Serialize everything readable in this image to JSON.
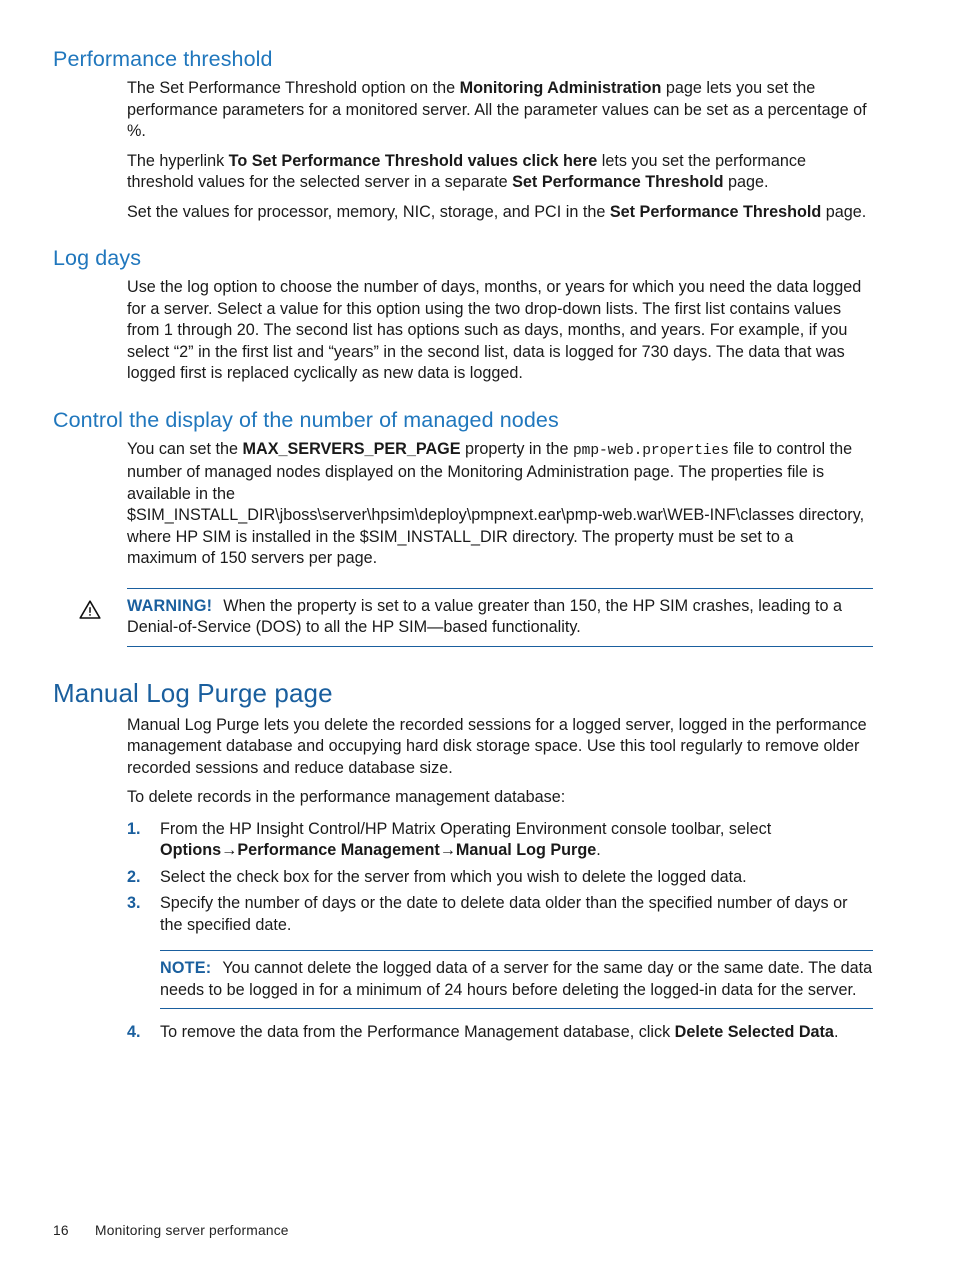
{
  "sections": {
    "performance_threshold": {
      "heading": "Performance threshold",
      "p1_a": "The Set Performance Threshold option on the ",
      "p1_b": "Monitoring Administration",
      "p1_c": " page lets you set the performance parameters for a monitored server. All the parameter values can be set as a percentage of %.",
      "p2_a": "The hyperlink ",
      "p2_b": "To Set Performance Threshold values click here",
      "p2_c": " lets you set the performance threshold values for the selected server in a separate ",
      "p2_d": "Set Performance Threshold",
      "p2_e": " page.",
      "p3_a": "Set the values for processor, memory, NIC, storage, and PCI in the ",
      "p3_b": "Set Performance Threshold",
      "p3_c": " page."
    },
    "log_days": {
      "heading": "Log days",
      "p1": "Use the log option to choose the number of days, months, or years for which you need the data logged for a server. Select a value for this option using the two drop-down lists. The first list contains values from 1 through 20. The second list has options such as days, months, and years. For example, if you select “2” in the first list and “years” in the second list, data is logged for 730 days. The data that was logged first is replaced cyclically as new data is logged."
    },
    "control_display": {
      "heading": "Control the display of the number of managed nodes",
      "p1_a": "You can set the ",
      "p1_b": "MAX_SERVERS_PER_PAGE",
      "p1_c": " property in the ",
      "p1_mono": "pmp-web.properties",
      "p1_d": " file to control the number of managed nodes displayed on the Monitoring Administration page. The properties file is available in the",
      "p1_path": "$SIM_INSTALL_DIR\\jboss\\server\\hpsim\\deploy\\pmpnext.ear\\pmp-web.war\\WEB-INF\\classes",
      "p1_e": " directory, where HP SIM is installed in the $SIM_INSTALL_DIR directory. The property must be set to a maximum of 150 servers per page."
    },
    "warning": {
      "icon": "warning-triangle-icon",
      "label": "WARNING!",
      "text": "When the property is set to a value greater than 150, the HP SIM crashes, leading to a Denial-of-Service (DOS) to all the HP SIM—based functionality."
    },
    "manual_log_purge": {
      "heading": "Manual Log Purge page",
      "p1": "Manual Log Purge lets you delete the recorded sessions for a logged server, logged in the performance management database and occupying hard disk storage space. Use this tool regularly to remove older recorded sessions and reduce database size.",
      "p2": "To delete records in the performance management database:",
      "steps": [
        {
          "num": "1.",
          "text_a": "From the HP Insight Control/HP Matrix Operating Environment console toolbar, select ",
          "text_b": "Options→Performance Management→Manual Log Purge",
          "text_c": "."
        },
        {
          "num": "2.",
          "text_a": "Select the check box for the server from which you wish to delete the logged data.",
          "text_b": "",
          "text_c": ""
        },
        {
          "num": "3.",
          "text_a": "Specify the number of days or the date to delete data older than the specified number of days or the specified date.",
          "text_b": "",
          "text_c": ""
        }
      ],
      "note": {
        "label": "NOTE:",
        "text": "You cannot delete the logged data of a server for the same day or the same date. The data needs to be logged in for a minimum of 24 hours before deleting the logged-in data for the server."
      },
      "step4": {
        "num": "4.",
        "text_a": "To remove the data from the Performance Management database, click ",
        "text_b": "Delete Selected Data",
        "text_c": "."
      }
    }
  },
  "footer": {
    "page_number": "16",
    "chapter_title": "Monitoring server performance"
  },
  "colors": {
    "heading_blue": "#2077bd",
    "h1_blue": "#1a5f9e",
    "rule_blue": "#1a5f9e",
    "body_text": "#1a1a1a"
  }
}
